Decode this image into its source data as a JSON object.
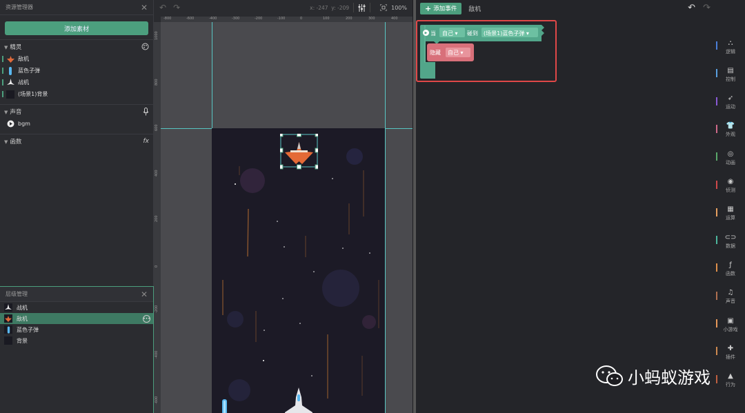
{
  "left": {
    "title": "资源管理器",
    "add_button": "添加素材",
    "sprites": {
      "header": "精灵",
      "items": [
        "敌机",
        "蓝色子弹",
        "战机",
        "(场景1)背景"
      ]
    },
    "sound": {
      "header": "声音",
      "items": [
        "bgm"
      ]
    },
    "functions": {
      "header": "函数",
      "icon_text": "fx"
    }
  },
  "layers": {
    "title": "层级管理",
    "items": [
      "战机",
      "敌机",
      "蓝色子弹",
      "背景"
    ],
    "selected_index": 1
  },
  "stage": {
    "coord_x": "x: -247",
    "coord_y": "y: -209",
    "zoom": "100%",
    "h_ticks": [
      "-800",
      "-600",
      "-400",
      "-300",
      "-200",
      "-100",
      "0",
      "100",
      "200",
      "300",
      "400"
    ],
    "v_ticks": [
      "1000",
      "800",
      "600",
      "400",
      "200",
      "0",
      "-200",
      "-400",
      "-600"
    ]
  },
  "right": {
    "add_event": "添加事件",
    "tab": "敌机",
    "block_when": "当",
    "block_self": "自己",
    "block_collide": "碰到",
    "block_target": "(场景1)蓝色子弹",
    "block_hide": "隐藏",
    "block_self2": "自己"
  },
  "categories": [
    {
      "label": "逻辑",
      "color": "#4a7fd8"
    },
    {
      "label": "控制",
      "color": "#5aa0e0"
    },
    {
      "label": "运动",
      "color": "#8a5ad6"
    },
    {
      "label": "外观",
      "color": "#d06a8a"
    },
    {
      "label": "动画",
      "color": "#5aa86a"
    },
    {
      "label": "侦测",
      "color": "#d0484a"
    },
    {
      "label": "运算",
      "color": "#e8a060"
    },
    {
      "label": "数据",
      "color": "#4cb89e"
    },
    {
      "label": "函数",
      "color": "#e0904a"
    },
    {
      "label": "声音",
      "color": "#b07050"
    },
    {
      "label": "小游戏",
      "color": "#e8985a"
    },
    {
      "label": "插件",
      "color": "#d08a50"
    },
    {
      "label": "行为",
      "color": "#c06040"
    }
  ],
  "watermark": "小蚂蚁游戏",
  "colors": {
    "accent": "#4c9f7e",
    "red_highlight": "#e04848",
    "hide_block": "#d8707a"
  }
}
